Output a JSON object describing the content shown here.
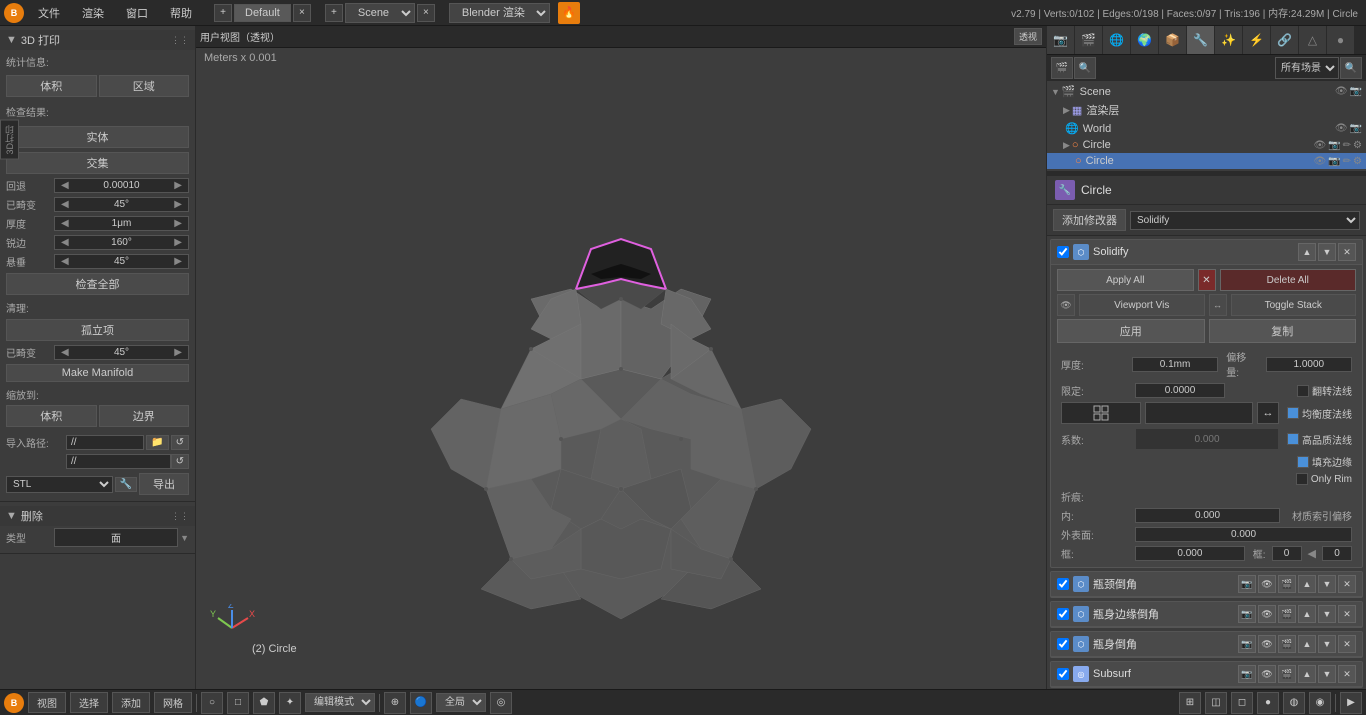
{
  "app": {
    "logo": "B",
    "menus": [
      "文件",
      "渲染",
      "窗口",
      "帮助"
    ],
    "workspace": "Default",
    "scene": "Scene",
    "engine": "Blender 渲染",
    "status": "v2.79 | Verts:0/102 | Edges:0/198 | Faces:0/97 | Tris:196 | 内存:24.29M | Circle"
  },
  "viewport": {
    "title": "用户视图（透视）",
    "info": "Meters x 0.001",
    "object_label": "(2) Circle"
  },
  "left_panel": {
    "print_header": "3D 打印",
    "stats_label": "统计信息:",
    "volume_label": "体积",
    "area_label": "区域",
    "check_label": "检查结果:",
    "solid": "实体",
    "intersect": "交集",
    "retreat_label": "回退",
    "retreat_val": "0.00010",
    "distort_label": "已畸变",
    "distort_val": "45°",
    "thickness_label": "厚度",
    "thickness_val": "1μm",
    "sharp_label": "锐边",
    "sharp_val": "160°",
    "overhang_label": "悬垂",
    "overhang_val": "45°",
    "check_all": "检查全部",
    "clean_label": "清理:",
    "isolated": "孤立项",
    "distort2_label": "已畸变",
    "distort2_val": "45°",
    "make_manifold": "Make Manifold",
    "scale_to": "缩放到:",
    "volume2": "体积",
    "edge2": "边界",
    "import_path": "导入路径:",
    "import_path_val": "//",
    "format": "STL",
    "export": "导出",
    "delete_header": "删除",
    "type_label": "类型",
    "type_val": "面"
  },
  "outliner": {
    "search_placeholder": "搜索",
    "all_scenes": "所有场景",
    "scene": "Scene",
    "render_layer": "渲染层",
    "world": "World",
    "circle": "Circle",
    "circle_selected": "Circle"
  },
  "properties": {
    "object_name": "Circle",
    "modifier_header": "添加修改器",
    "modifiers": [
      {
        "name": "Solidify",
        "apply_label": "应用",
        "copy_label": "复制",
        "viewport_label": "Viewport Vis",
        "toggle_label": "Toggle Stack",
        "apply_all_label": "Apply All",
        "delete_label": "Delete All",
        "thickness_label": "厚度:",
        "thickness_val": "0.1mm",
        "offset_label": "偏移量:",
        "offset_val": "1.0000",
        "limit_label": "限定:",
        "limit_val": "0.0000",
        "flip_label": "翻转法线",
        "balance_label": "均衡度法线",
        "high_quality_label": "高品质法线",
        "fill_rim_label": "填充边缘",
        "only_rim_label": "Only Rim",
        "crease_label": "折痕:",
        "crease_inner": "内:",
        "crease_inner_val": "0.000",
        "crease_outer": "外表面:",
        "crease_outer_val": "0.000",
        "crease_frame": "框:",
        "crease_frame_val": "0.000",
        "mat_offset_label": "材质索引偏移",
        "frame_label": "框:",
        "frame_val": "0",
        "frame_val2": "0",
        "coeff_label": "系数:",
        "coeff_val": "0.000"
      },
      {
        "name": "瓶颈倒角",
        "icon_color": "#5b8cc8"
      },
      {
        "name": "瓶身边缘倒角",
        "icon_color": "#5b8cc8"
      },
      {
        "name": "瓶身倒角",
        "icon_color": "#5b8cc8"
      },
      {
        "name": "Subsurf",
        "icon_color": "#5b8cc8"
      }
    ]
  },
  "bottom_bar": {
    "logo": "B",
    "view_label": "视图",
    "select_label": "选择",
    "add_label": "添加",
    "mesh_label": "网格",
    "mode_label": "编辑模式",
    "global_label": "全局"
  }
}
